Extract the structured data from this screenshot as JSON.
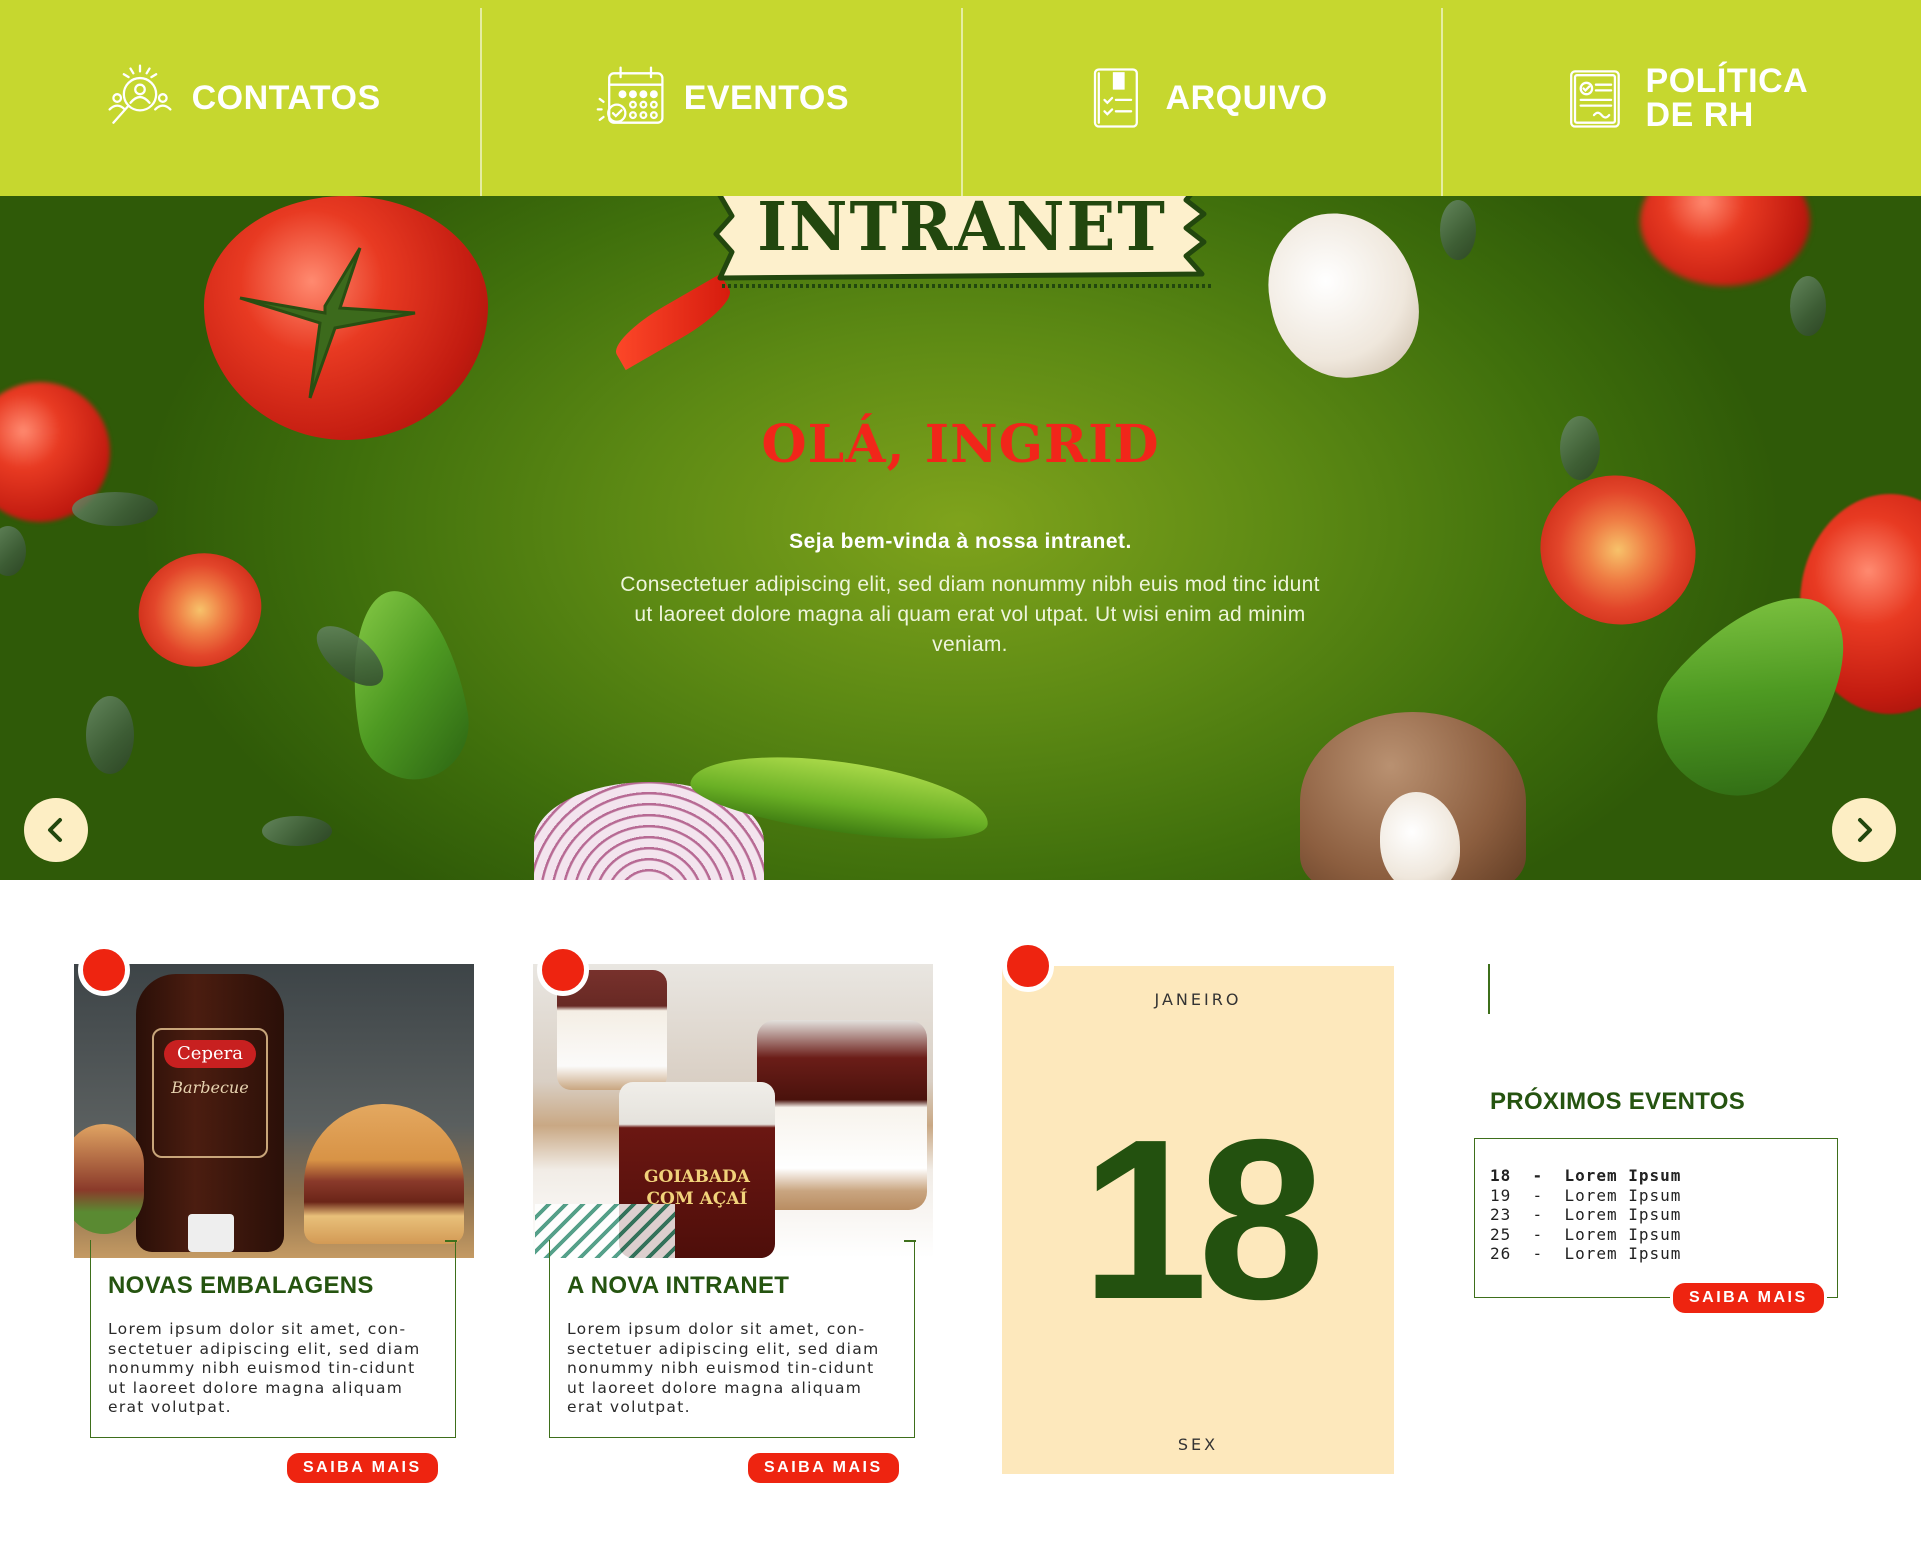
{
  "nav": {
    "items": [
      {
        "label": "CONTATOS",
        "icon": "contacts-search-icon"
      },
      {
        "label": "EVENTOS",
        "icon": "calendar-icon"
      },
      {
        "label": "ARQUIVO",
        "icon": "file-archive-icon"
      },
      {
        "label": "POLÍTICA\nDE RH",
        "icon": "certificate-document-icon"
      }
    ]
  },
  "hero": {
    "banner": "INTRANET",
    "greeting": "OLÁ, INGRID",
    "welcome": "Seja bem-vinda à nossa intranet.",
    "body": "Consectetuer adipiscing elit, sed diam nonummy nibh euis mod tinc idunt ut laoreet dolore magna ali quam erat vol utpat. Ut wisi enim ad minim veniam.",
    "prev_icon": "chevron-left-icon",
    "next_icon": "chevron-right-icon"
  },
  "cards": [
    {
      "title": "NOVAS EMBALAGENS",
      "text": "Lorem ipsum dolor sit amet, con-sectetuer adipiscing elit, sed diam nonummy nibh euismod tin-cidunt ut laoreet dolore magna aliquam erat volutpat.",
      "button": "SAIBA MAIS",
      "image_brand": "Cepera",
      "image_label": "Barbecue"
    },
    {
      "title": "A NOVA INTRANET",
      "text": "Lorem ipsum dolor sit amet, con-sectetuer adipiscing elit, sed diam nonummy nibh euismod tin-cidunt ut laoreet dolore magna aliquam erat volutpat.",
      "button": "SAIBA MAIS",
      "image_label": "GOIABADA COM AÇAÍ"
    }
  ],
  "calendar": {
    "month": "JANEIRO",
    "day": "18",
    "weekday": "SEX"
  },
  "events": {
    "title": "PRÓXIMOS EVENTOS",
    "items": [
      {
        "day": "18",
        "sep": "-",
        "name": "Lorem Ipsum"
      },
      {
        "day": "19",
        "sep": "-",
        "name": "Lorem Ipsum"
      },
      {
        "day": "23",
        "sep": "-",
        "name": "Lorem Ipsum"
      },
      {
        "day": "25",
        "sep": "-",
        "name": "Lorem Ipsum"
      },
      {
        "day": "26",
        "sep": "-",
        "name": "Lorem Ipsum"
      }
    ],
    "button": "SAIBA MAIS"
  },
  "colors": {
    "nav_bg": "#c6d72f",
    "hero_green": "#5d8a14",
    "accent_red": "#ee2410",
    "title_green": "#255410",
    "calendar_bg": "#fde8bc"
  }
}
